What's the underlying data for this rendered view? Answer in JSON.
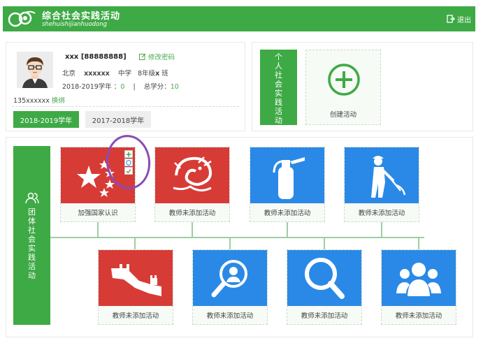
{
  "header": {
    "title": "综合社会实践活动",
    "subtitle": "shehuishijianhuodong",
    "logout_label": "退出"
  },
  "profile": {
    "name": "xxx [88888888]",
    "change_password": "修改密码",
    "city": "北京",
    "school": "xxxxxx",
    "stage": "中学",
    "grade_prefix": "8年级",
    "grade_mark": "x",
    "grade_suffix": "班",
    "year_label": "2018-2019学年 ：",
    "year_value": "0",
    "total_label": "总学分：",
    "total_value": "10",
    "phone": "135xxxxxx",
    "bind_label": "换绑",
    "year_tabs": [
      "2018-2019学年",
      "2017-2018学年"
    ]
  },
  "personal": {
    "label_chars": [
      "个",
      "人",
      "社",
      "会",
      "实",
      "践",
      "活",
      "动"
    ],
    "create_label": "创建活动"
  },
  "group": {
    "label_chars": [
      "团",
      "体",
      "社",
      "会",
      "实",
      "践",
      "活",
      "动"
    ],
    "tiles": [
      {
        "caption": "加强国家认识",
        "image": "flag-icon"
      },
      {
        "caption": "教师未添加活动",
        "image": "dragon-icon"
      },
      {
        "caption": "教师未添加活动",
        "image": "fire-extinguisher-icon"
      },
      {
        "caption": "教师未添加活动",
        "image": "worker-icon"
      },
      {
        "caption": "教师未添加活动",
        "image": "great-wall-icon"
      },
      {
        "caption": "教师未添加活动",
        "image": "person-search-icon"
      },
      {
        "caption": "教师未添加活动",
        "image": "magnifier-icon"
      },
      {
        "caption": "教师未添加活动",
        "image": "group-icon"
      }
    ],
    "mini_actions": [
      "plus-icon",
      "shield-icon",
      "check-icon"
    ]
  },
  "colors": {
    "brand_green": "#3eaa45",
    "tile_red": "#d73b36",
    "tile_blue": "#2a89e6",
    "annotation_purple": "#8b4bb5"
  }
}
